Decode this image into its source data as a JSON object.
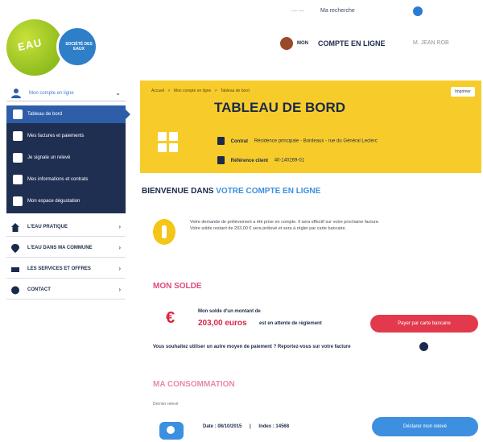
{
  "topbar": {
    "link_a": "— —",
    "link_b": "Ma recherche"
  },
  "logo": {
    "text": "EAU",
    "sub": "SOCIÉTÉ DES EAUX"
  },
  "account": {
    "pre": "MON",
    "label": "COMPTE EN LIGNE",
    "user": "M. JEAN ROB"
  },
  "sidebar": {
    "head": "Mon compte en ligne",
    "submenu": [
      {
        "label": "Tableau de bord",
        "icon": "dashboard-icon",
        "active": true
      },
      {
        "label": "Mes factures et paiements",
        "icon": "invoice-icon",
        "active": false
      },
      {
        "label": "Je signale un relevé",
        "icon": "meter-icon",
        "active": false
      },
      {
        "label": "Mes informations et contrats",
        "icon": "contract-icon",
        "active": false
      },
      {
        "label": "Mon espace dégustation",
        "icon": "glass-icon",
        "active": false
      }
    ],
    "items": [
      {
        "label": "L'EAU PRATIQUE",
        "icon": "home-icon"
      },
      {
        "label": "L'EAU DANS MA COMMUNE",
        "icon": "pin-icon"
      },
      {
        "label": "LES SERVICES ET OFFRES",
        "icon": "services-icon"
      },
      {
        "label": "CONTACT",
        "icon": "contact-icon"
      }
    ]
  },
  "header": {
    "crumbs": [
      "Accueil",
      ">",
      "Mon compte en ligne",
      ">",
      "Tableau de bord"
    ],
    "print": "Imprimer",
    "title": "TABLEAU DE BORD",
    "contract_key": "Contrat",
    "contract_value": "Résidence principale - Bordeaux - rue du Général Leclerc",
    "client_key": "Référence client",
    "client_value": "40-140269-01"
  },
  "welcome": {
    "prefix": "BIENVENUE DANS",
    "accent": "VOTRE COMPTE EN LIGNE"
  },
  "notice": {
    "line1": "Votre demande de prélèvement a été prise en compte. Il sera effectif sur votre prochaine facture.",
    "line2": "Votre solde restant de 203,00 € sera prélevé et sera à régler par carte bancaire."
  },
  "solde": {
    "title": "MON SOLDE",
    "line1": "Mon solde d'un montant de",
    "amount": "203,00 euros",
    "line2": "est en attente de règlement",
    "pay_button": "Payer par carte bancaire",
    "alt_payment": "Vous souhaitez utiliser un autre moyen de paiement ? Reportez-vous sur votre facture"
  },
  "conso": {
    "title": "MA CONSOMMATION",
    "label": "Dernier relevé",
    "date": "Date : 08/10/2015",
    "index": "Index : 14568",
    "releve_button": "Déclarer mon relevé"
  },
  "colors": {
    "navy": "#1e2f52",
    "accent_blue": "#3d8fe0",
    "yellow": "#f7cc2a",
    "red": "#e23a4c",
    "pink": "#e14b7a"
  }
}
